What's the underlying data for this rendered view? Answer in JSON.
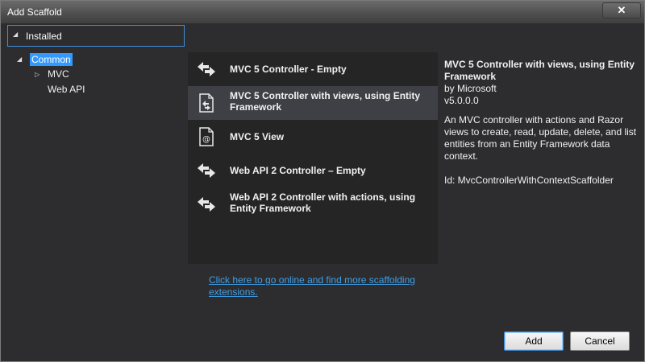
{
  "window": {
    "title": "Add Scaffold",
    "close_glyph": "✕"
  },
  "installed": {
    "label": "Installed"
  },
  "tree": {
    "common": "Common",
    "mvc": "MVC",
    "web_api": "Web API"
  },
  "list": [
    {
      "label": "MVC 5 Controller - Empty",
      "icon": "controller-icon"
    },
    {
      "label": "MVC 5 Controller with views, using Entity Framework",
      "icon": "controller-views-icon"
    },
    {
      "label": "MVC 5 View",
      "icon": "view-file-icon"
    },
    {
      "label": "Web API 2 Controller – Empty",
      "icon": "controller-icon"
    },
    {
      "label": "Web API 2 Controller with actions, using Entity Framework",
      "icon": "controller-icon"
    }
  ],
  "details": {
    "title": "MVC 5 Controller with views, using Entity Framework",
    "author": "by Microsoft",
    "version": "v5.0.0.0",
    "description": "An MVC controller with actions and Razor views to create, read, update, delete, and list entities from an Entity Framework data context.",
    "id": "Id: MvcControllerWithContextScaffolder"
  },
  "link": "Click here to go online and find more scaffolding extensions.",
  "buttons": {
    "add": "Add",
    "cancel": "Cancel"
  },
  "colors": {
    "accent": "#3399ff",
    "link": "#3f9fe6",
    "panel": "#252526",
    "selected": "#3f3f46"
  }
}
